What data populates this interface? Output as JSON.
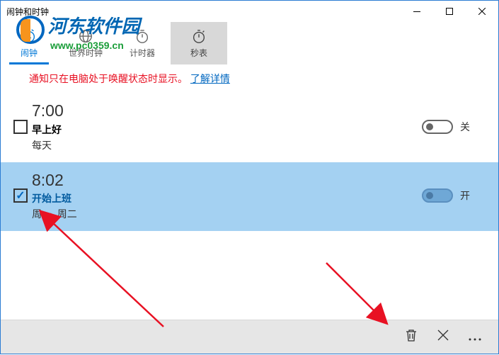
{
  "titlebar": {
    "title": "闹钟和时钟"
  },
  "tabs": [
    {
      "label": "闹钟",
      "icon": "clock-icon",
      "state": "active"
    },
    {
      "label": "世界时钟",
      "icon": "globe-icon",
      "state": ""
    },
    {
      "label": "计时器",
      "icon": "timer-icon",
      "state": ""
    },
    {
      "label": "秒表",
      "icon": "stopwatch-icon",
      "state": "selected"
    }
  ],
  "notice": {
    "text": "通知只在电脑处于唤醒状态时显示。",
    "link": "了解详情"
  },
  "alarms": [
    {
      "time": "7:00",
      "name": "早上好",
      "repeat": "每天",
      "toggle": "关",
      "checked": false,
      "selected": false
    },
    {
      "time": "8:02",
      "name": "开始上班",
      "repeat": "周一, 周二",
      "toggle": "开",
      "checked": true,
      "selected": true
    }
  ],
  "bottombar": {
    "delete": "trash",
    "cancel": "close",
    "more": "more"
  },
  "watermark": {
    "text": "河东软件园",
    "url": "www.pc0359.cn"
  }
}
